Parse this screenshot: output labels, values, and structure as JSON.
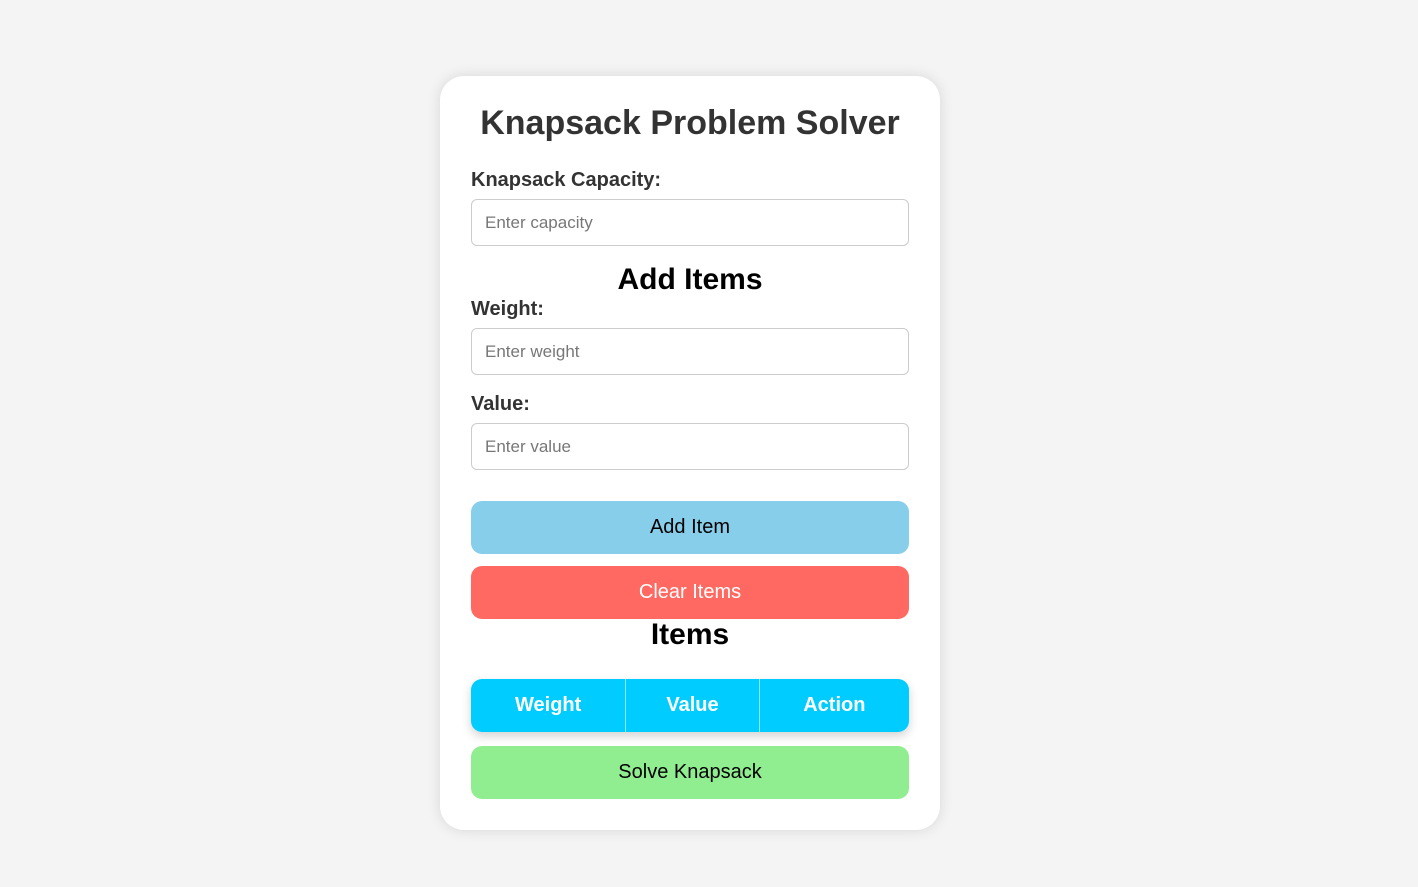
{
  "app": {
    "title": "Knapsack Problem Solver"
  },
  "capacity": {
    "label": "Knapsack Capacity:",
    "placeholder": "Enter capacity",
    "value": ""
  },
  "add_items": {
    "heading": "Add Items",
    "weight_label": "Weight:",
    "weight_placeholder": "Enter weight",
    "value_label": "Value:",
    "value_placeholder": "Enter value"
  },
  "buttons": {
    "add_item": "Add Item",
    "clear_items": "Clear Items",
    "solve": "Solve Knapsack"
  },
  "items": {
    "heading": "Items",
    "columns": [
      "Weight",
      "Value",
      "Action"
    ],
    "rows": []
  },
  "colors": {
    "background": "#f4f4f4",
    "add_button": "#87ceeb",
    "clear_button": "#ff6961",
    "solve_button": "#90ee90",
    "table_header": "#00ccff"
  }
}
